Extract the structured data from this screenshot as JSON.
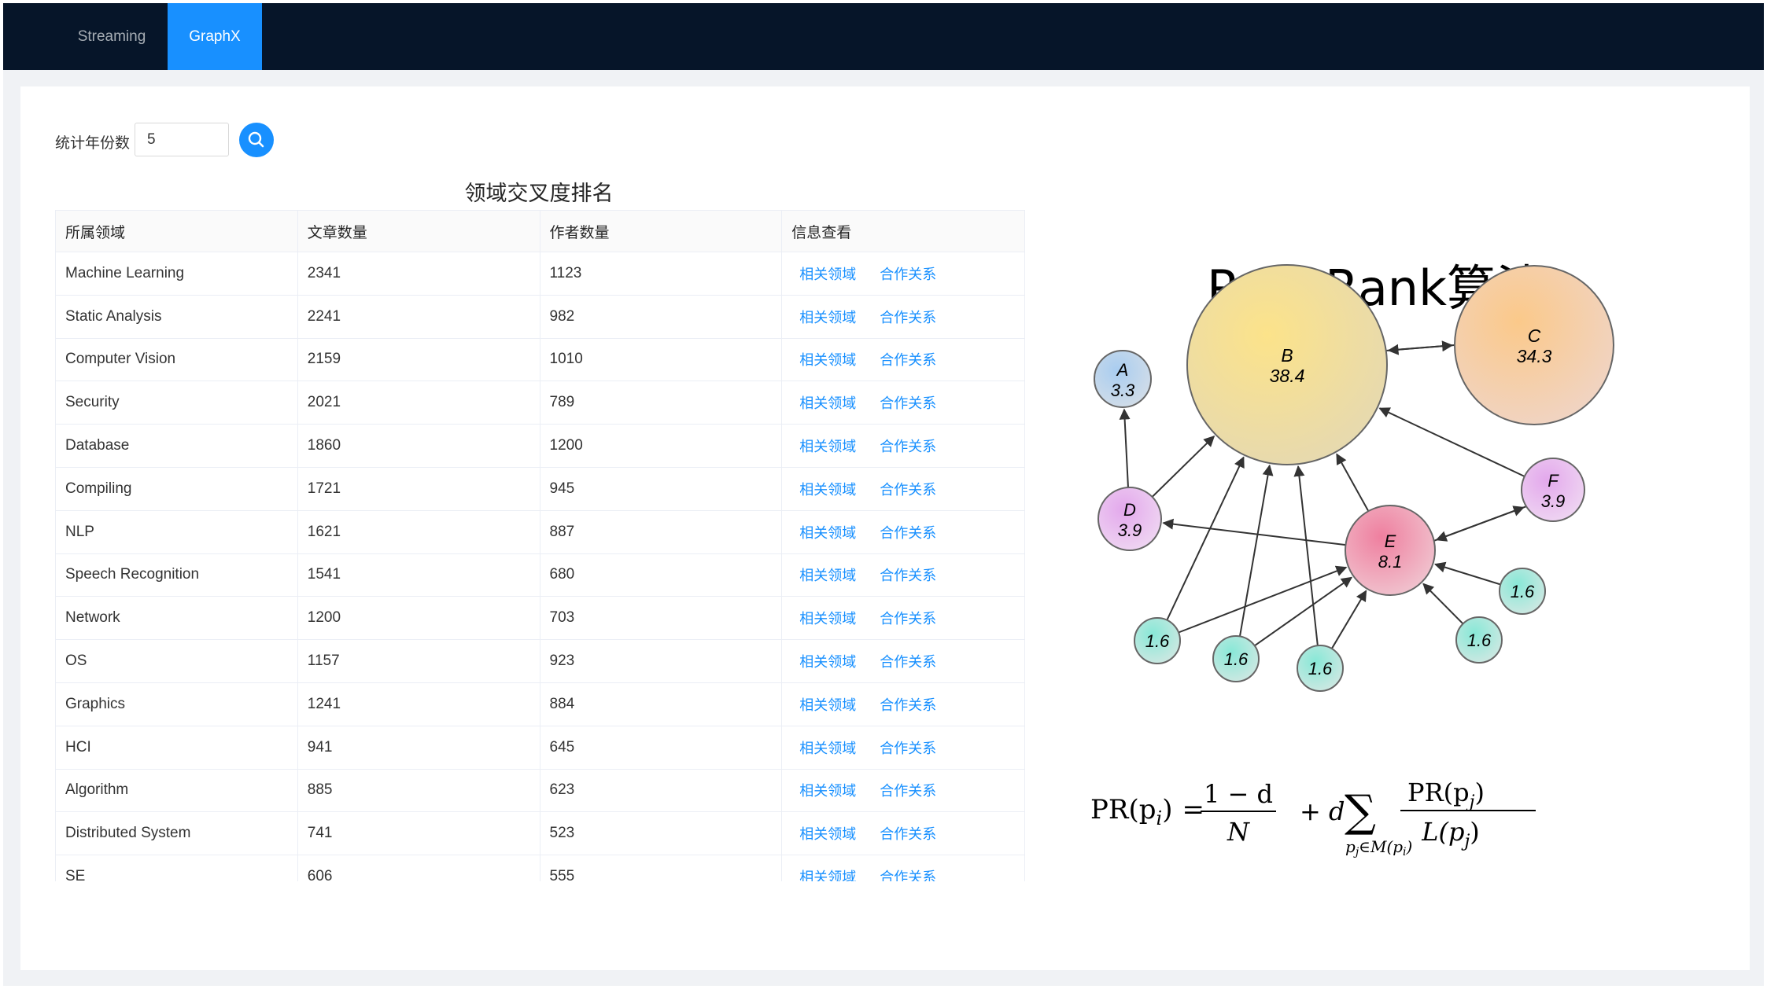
{
  "nav": {
    "tabs": [
      {
        "label": "Streaming",
        "active": false
      },
      {
        "label": "GraphX",
        "active": true
      }
    ],
    "active_color": "#1890ff",
    "background": "#061529"
  },
  "filter": {
    "label": "统计年份数",
    "value": "5",
    "search_icon": "search-icon"
  },
  "table": {
    "title": "领域交叉度排名",
    "columns": [
      "所属领域",
      "文章数量",
      "作者数量",
      "信息查看"
    ],
    "link_labels": [
      "相关领域",
      "合作关系"
    ],
    "rows": [
      {
        "field": "Machine Learning",
        "articles": "2341",
        "authors": "1123"
      },
      {
        "field": "Static Analysis",
        "articles": "2241",
        "authors": "982"
      },
      {
        "field": "Computer Vision",
        "articles": "2159",
        "authors": "1010"
      },
      {
        "field": "Security",
        "articles": "2021",
        "authors": "789"
      },
      {
        "field": "Database",
        "articles": "1860",
        "authors": "1200"
      },
      {
        "field": "Compiling",
        "articles": "1721",
        "authors": "945"
      },
      {
        "field": "NLP",
        "articles": "1621",
        "authors": "887"
      },
      {
        "field": "Speech Recognition",
        "articles": "1541",
        "authors": "680"
      },
      {
        "field": "Network",
        "articles": "1200",
        "authors": "703"
      },
      {
        "field": "OS",
        "articles": "1157",
        "authors": "923"
      },
      {
        "field": "Graphics",
        "articles": "1241",
        "authors": "884"
      },
      {
        "field": "HCI",
        "articles": "941",
        "authors": "645"
      },
      {
        "field": "Algorithm",
        "articles": "885",
        "authors": "623"
      },
      {
        "field": "Distributed System",
        "articles": "741",
        "authors": "523"
      },
      {
        "field": "SE",
        "articles": "606",
        "authors": "555"
      }
    ]
  },
  "algorithm": {
    "title": "PageRank算法",
    "nodes": [
      {
        "id": "A",
        "label": "A",
        "score": "3.3"
      },
      {
        "id": "B",
        "label": "B",
        "score": "38.4"
      },
      {
        "id": "C",
        "label": "C",
        "score": "34.3"
      },
      {
        "id": "D",
        "label": "D",
        "score": "3.9"
      },
      {
        "id": "E",
        "label": "E",
        "score": "8.1"
      },
      {
        "id": "F",
        "label": "F",
        "score": "3.9"
      },
      {
        "id": "n1",
        "label": "",
        "score": "1.6"
      },
      {
        "id": "n2",
        "label": "",
        "score": "1.6"
      },
      {
        "id": "n3",
        "label": "",
        "score": "1.6"
      },
      {
        "id": "n4",
        "label": "",
        "score": "1.6"
      },
      {
        "id": "n5",
        "label": "",
        "score": "1.6"
      }
    ],
    "edges": [
      [
        "D",
        "A"
      ],
      [
        "D",
        "B"
      ],
      [
        "E",
        "D"
      ],
      [
        "E",
        "B"
      ],
      [
        "B",
        "C"
      ],
      [
        "C",
        "B"
      ],
      [
        "F",
        "B"
      ],
      [
        "F",
        "E"
      ],
      [
        "E",
        "F"
      ],
      [
        "n1",
        "B"
      ],
      [
        "n1",
        "E"
      ],
      [
        "n2",
        "B"
      ],
      [
        "n2",
        "E"
      ],
      [
        "n3",
        "B"
      ],
      [
        "n3",
        "E"
      ],
      [
        "n4",
        "E"
      ],
      [
        "n5",
        "E"
      ]
    ],
    "formula": {
      "lhs": "PR(p",
      "lhs_sub": "i",
      "frac1_num": "1 − d",
      "frac1_den": "N",
      "plus_d": "+ d",
      "sum_sub": "p",
      "sum_sub_j": "j",
      "sum_sub_rest": "∈M(p",
      "frac2_num": "PR(p",
      "frac2_den": "L(p"
    }
  }
}
